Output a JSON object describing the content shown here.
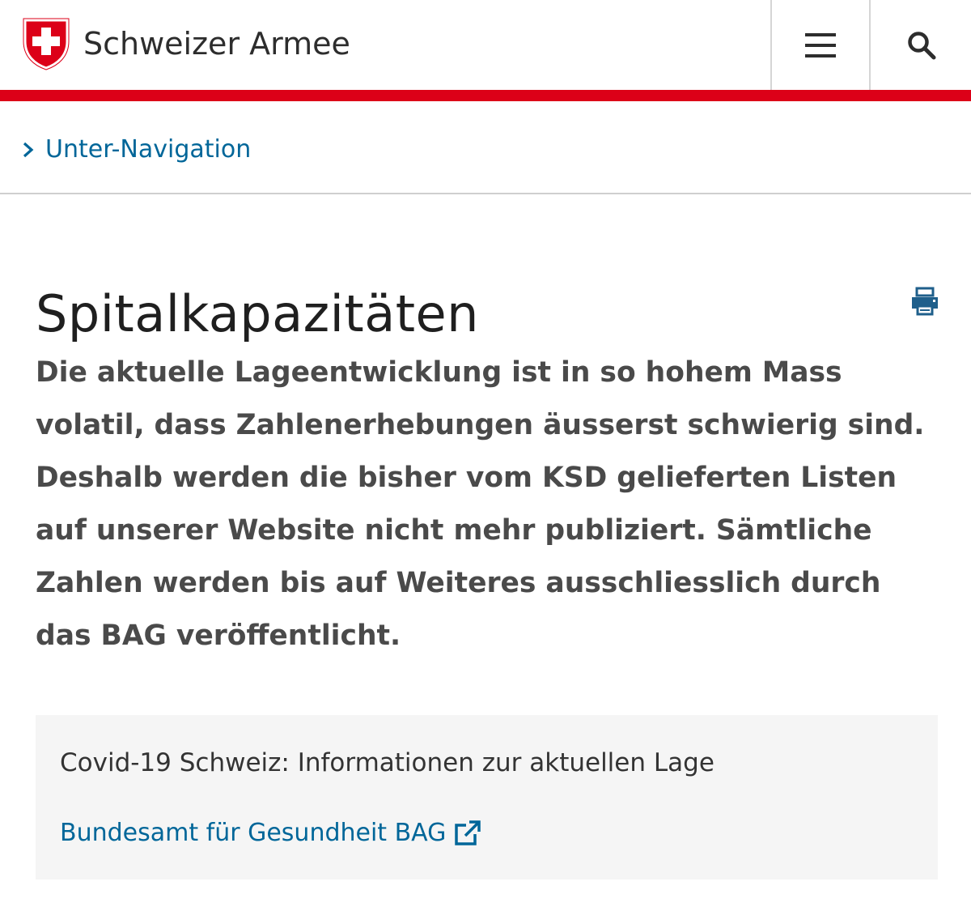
{
  "header": {
    "brand_name": "Schweizer Armee",
    "logo_icon": "swiss-shield-icon",
    "menu_icon": "hamburger-menu-icon",
    "search_icon": "search-icon",
    "accent_color": "#dc0018"
  },
  "subnav": {
    "label": "Unter-Navigation",
    "icon": "chevron-right-icon",
    "link_color": "#006699"
  },
  "content": {
    "title": "Spitalkapazitäten",
    "print_icon": "print-icon",
    "lead": "Die aktuelle Lageentwicklung ist in so hohem Mass volatil, dass Zahlenerhebungen äusserst schwierig sind. Deshalb werden die bisher vom KSD gelieferten Listen auf unserer Website nicht mehr publiziert. Sämtliche Zahlen werden bis auf Weiteres ausschliesslich durch das BAG veröffentlicht."
  },
  "info_box": {
    "text": "Covid-19 Schweiz: Informationen zur aktuellen Lage",
    "link_label": "Bundesamt für Gesundheit BAG",
    "link_icon": "external-link-icon"
  }
}
